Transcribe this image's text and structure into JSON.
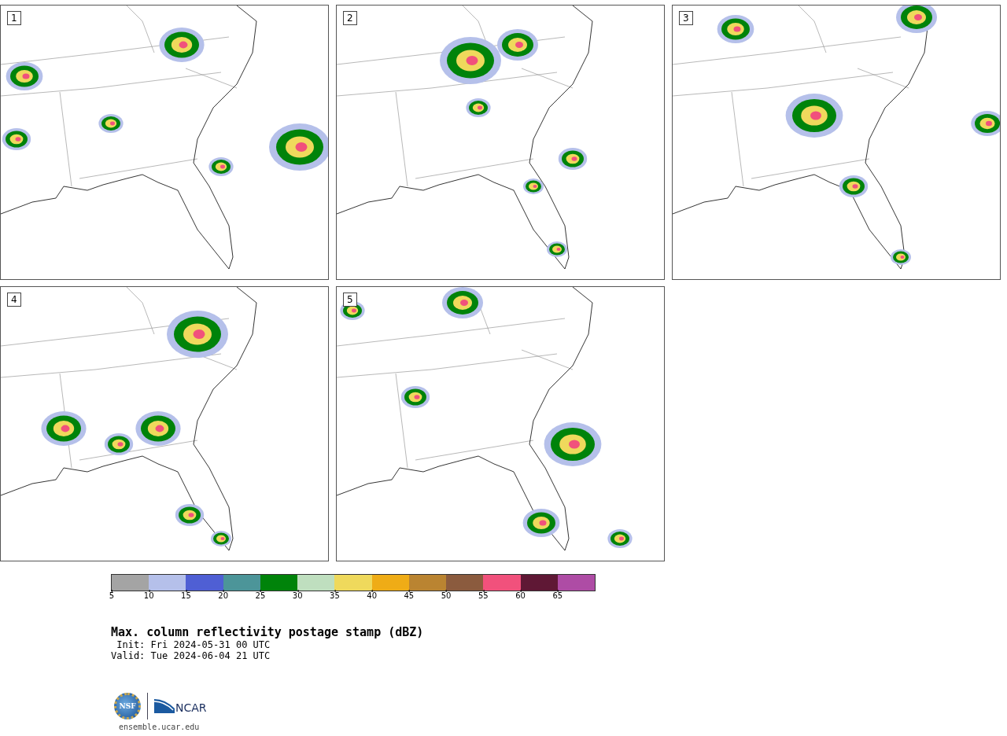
{
  "panels": [
    {
      "label": "1"
    },
    {
      "label": "2"
    },
    {
      "label": "3"
    },
    {
      "label": "4"
    },
    {
      "label": "5"
    }
  ],
  "colorbar": {
    "bins": [
      {
        "color": "#a4a4a4",
        "tick": "5"
      },
      {
        "color": "#b5c0ea",
        "tick": "10"
      },
      {
        "color": "#4f5fd4",
        "tick": "15"
      },
      {
        "color": "#4c9599",
        "tick": "20"
      },
      {
        "color": "#00830a",
        "tick": "25"
      },
      {
        "color": "#bfdfbf",
        "tick": "30"
      },
      {
        "color": "#efd95c",
        "tick": "35"
      },
      {
        "color": "#efac16",
        "tick": "40"
      },
      {
        "color": "#ba8431",
        "tick": "45"
      },
      {
        "color": "#8b5b3e",
        "tick": "50"
      },
      {
        "color": "#f1517c",
        "tick": "55"
      },
      {
        "color": "#5f1835",
        "tick": "60"
      },
      {
        "color": "#ae4ca5",
        "tick": "65"
      }
    ]
  },
  "title": "Max. column reflectivity postage stamp (dBZ)",
  "init": " Init: Fri 2024-05-31 00 UTC",
  "valid": "Valid: Tue 2024-06-04 21 UTC",
  "logos": {
    "nsf": "NSF",
    "ncar": "NCAR"
  },
  "footer_link": "ensemble.ucar.edu"
}
